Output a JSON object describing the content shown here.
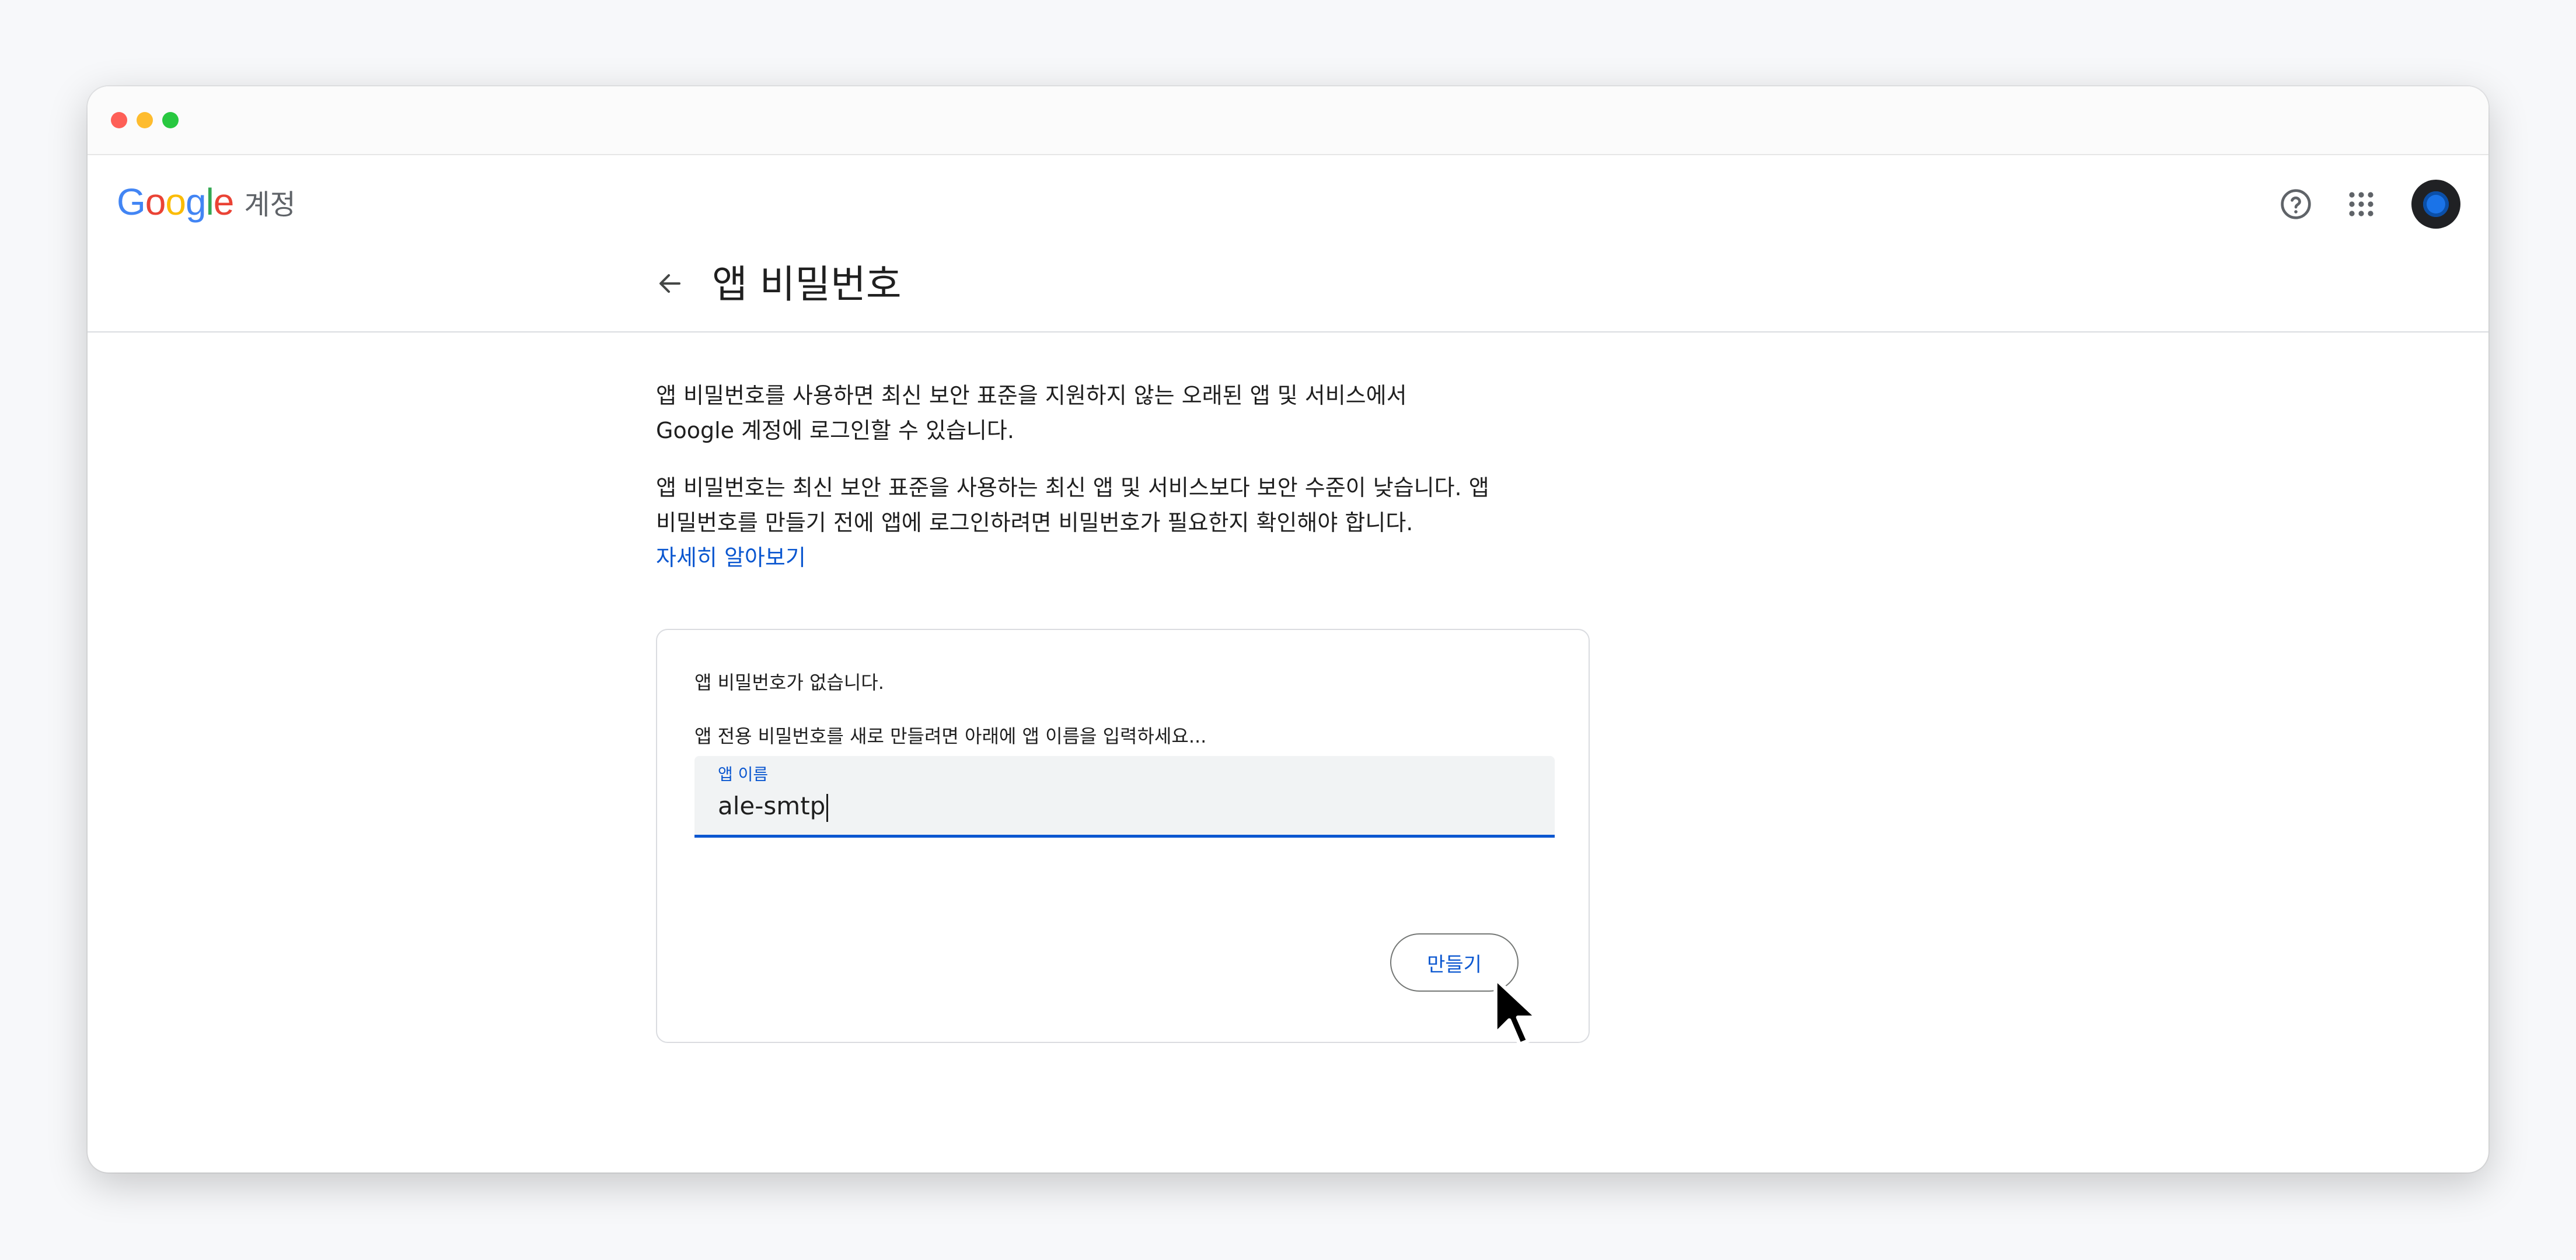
{
  "window": {
    "controls": [
      "close",
      "minimize",
      "zoom"
    ]
  },
  "header": {
    "logo_text": "Google",
    "logo_suffix": "계정",
    "help_icon": "help-circle-icon",
    "apps_icon": "apps-grid-icon",
    "avatar_icon": "account-avatar"
  },
  "page": {
    "back_icon": "arrow-left-icon",
    "title": "앱 비밀번호"
  },
  "content": {
    "para1": "앱 비밀번호를 사용하면 최신 보안 표준을 지원하지 않는 오래된 앱 및 서비스에서\nGoogle 계정에 로그인할 수 있습니다.",
    "para2": "앱 비밀번호는 최신 보안 표준을 사용하는 최신 앱 및 서비스보다 보안 수준이 낮습니다. 앱\n비밀번호를 만들기 전에 앱에 로그인하려면 비밀번호가 필요한지 확인해야 합니다.",
    "learn_more": "자세히 알아보기"
  },
  "card": {
    "empty_text": "앱 비밀번호가 없습니다.",
    "instruction": "앱 전용 비밀번호를 새로 만들려면 아래에 앱 이름을 입력하세요...",
    "field_label": "앱 이름",
    "field_value": "ale-smtp",
    "create_button": "만들기"
  },
  "colors": {
    "accent": "#0b57d0",
    "field_bg": "#f1f3f4",
    "divider": "#dadce0"
  }
}
